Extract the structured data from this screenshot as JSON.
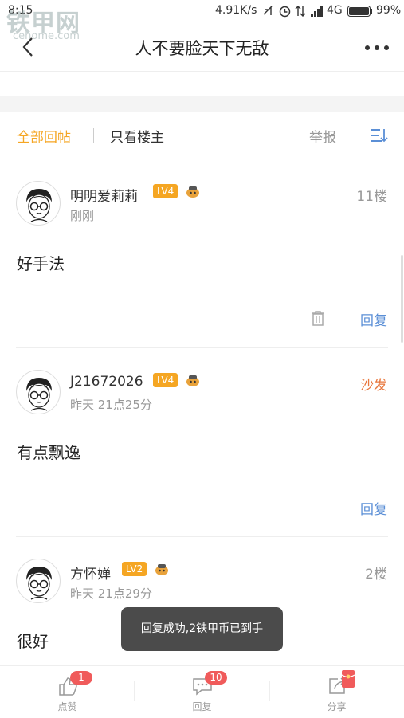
{
  "status_bar": {
    "time": "8:15",
    "speed": "4.91K/s",
    "network": "4G",
    "battery": "99%"
  },
  "watermark": {
    "brand": "铁甲网",
    "domain": "cehome.com"
  },
  "nav": {
    "title": "人不要脸天下无敌"
  },
  "filter": {
    "all_replies": "全部回帖",
    "only_op": "只看楼主",
    "report": "举报"
  },
  "posts": [
    {
      "name": "明明爱莉莉",
      "level": "LV4",
      "time": "刚刚",
      "floor": "11楼",
      "content": "好手法",
      "reply": "回复"
    },
    {
      "name": "J21672026",
      "level": "LV4",
      "time": "昨天 21点25分",
      "floor": "沙发",
      "content": "有点飘逸",
      "reply": "回复"
    },
    {
      "name": "方怀婵",
      "level": "LV2",
      "time": "昨天 21点29分",
      "floor": "2楼",
      "content": "很好"
    }
  ],
  "colors": {
    "accent": "#f5a623",
    "reply_link": "#5b8fd6",
    "sofa": "#e8773d",
    "badge": "#f05b5b"
  },
  "toast": {
    "message": "回复成功,2铁甲币已到手"
  },
  "bottom_bar": {
    "like": {
      "label": "点赞",
      "count": "1"
    },
    "reply": {
      "label": "回复",
      "count": "10"
    },
    "share": {
      "label": "分享"
    }
  }
}
